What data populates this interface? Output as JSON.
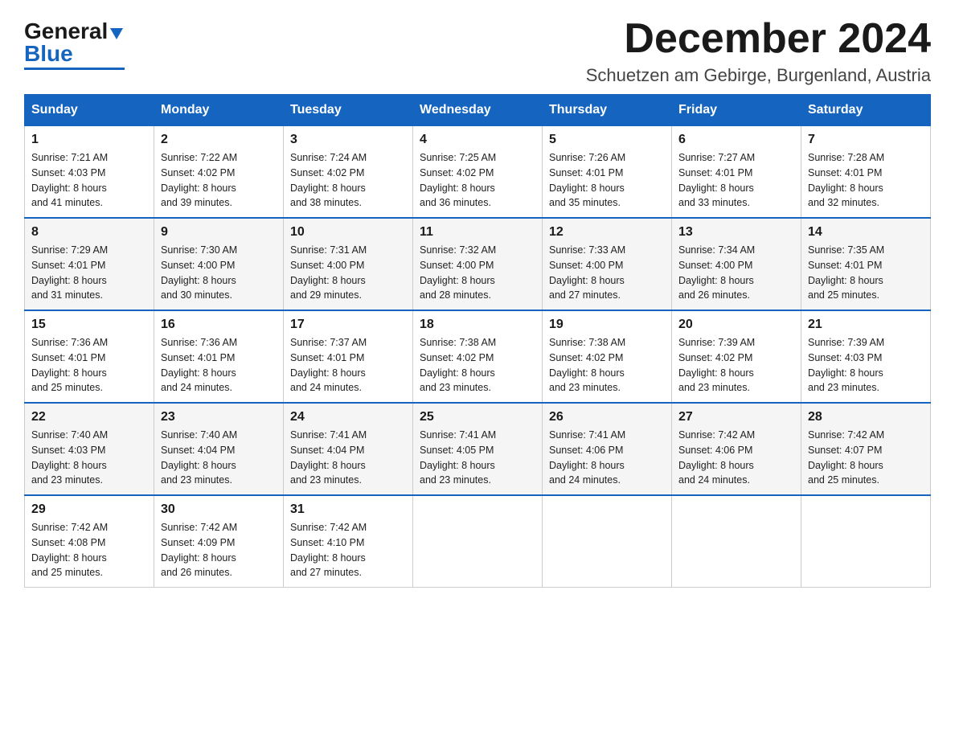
{
  "header": {
    "logo_general": "General",
    "logo_blue": "Blue",
    "month_title": "December 2024",
    "location": "Schuetzen am Gebirge, Burgenland, Austria"
  },
  "days_of_week": [
    "Sunday",
    "Monday",
    "Tuesday",
    "Wednesday",
    "Thursday",
    "Friday",
    "Saturday"
  ],
  "weeks": [
    [
      {
        "day": "1",
        "sunrise": "7:21 AM",
        "sunset": "4:03 PM",
        "daylight": "8 hours and 41 minutes."
      },
      {
        "day": "2",
        "sunrise": "7:22 AM",
        "sunset": "4:02 PM",
        "daylight": "8 hours and 39 minutes."
      },
      {
        "day": "3",
        "sunrise": "7:24 AM",
        "sunset": "4:02 PM",
        "daylight": "8 hours and 38 minutes."
      },
      {
        "day": "4",
        "sunrise": "7:25 AM",
        "sunset": "4:02 PM",
        "daylight": "8 hours and 36 minutes."
      },
      {
        "day": "5",
        "sunrise": "7:26 AM",
        "sunset": "4:01 PM",
        "daylight": "8 hours and 35 minutes."
      },
      {
        "day": "6",
        "sunrise": "7:27 AM",
        "sunset": "4:01 PM",
        "daylight": "8 hours and 33 minutes."
      },
      {
        "day": "7",
        "sunrise": "7:28 AM",
        "sunset": "4:01 PM",
        "daylight": "8 hours and 32 minutes."
      }
    ],
    [
      {
        "day": "8",
        "sunrise": "7:29 AM",
        "sunset": "4:01 PM",
        "daylight": "8 hours and 31 minutes."
      },
      {
        "day": "9",
        "sunrise": "7:30 AM",
        "sunset": "4:00 PM",
        "daylight": "8 hours and 30 minutes."
      },
      {
        "day": "10",
        "sunrise": "7:31 AM",
        "sunset": "4:00 PM",
        "daylight": "8 hours and 29 minutes."
      },
      {
        "day": "11",
        "sunrise": "7:32 AM",
        "sunset": "4:00 PM",
        "daylight": "8 hours and 28 minutes."
      },
      {
        "day": "12",
        "sunrise": "7:33 AM",
        "sunset": "4:00 PM",
        "daylight": "8 hours and 27 minutes."
      },
      {
        "day": "13",
        "sunrise": "7:34 AM",
        "sunset": "4:00 PM",
        "daylight": "8 hours and 26 minutes."
      },
      {
        "day": "14",
        "sunrise": "7:35 AM",
        "sunset": "4:01 PM",
        "daylight": "8 hours and 25 minutes."
      }
    ],
    [
      {
        "day": "15",
        "sunrise": "7:36 AM",
        "sunset": "4:01 PM",
        "daylight": "8 hours and 25 minutes."
      },
      {
        "day": "16",
        "sunrise": "7:36 AM",
        "sunset": "4:01 PM",
        "daylight": "8 hours and 24 minutes."
      },
      {
        "day": "17",
        "sunrise": "7:37 AM",
        "sunset": "4:01 PM",
        "daylight": "8 hours and 24 minutes."
      },
      {
        "day": "18",
        "sunrise": "7:38 AM",
        "sunset": "4:02 PM",
        "daylight": "8 hours and 23 minutes."
      },
      {
        "day": "19",
        "sunrise": "7:38 AM",
        "sunset": "4:02 PM",
        "daylight": "8 hours and 23 minutes."
      },
      {
        "day": "20",
        "sunrise": "7:39 AM",
        "sunset": "4:02 PM",
        "daylight": "8 hours and 23 minutes."
      },
      {
        "day": "21",
        "sunrise": "7:39 AM",
        "sunset": "4:03 PM",
        "daylight": "8 hours and 23 minutes."
      }
    ],
    [
      {
        "day": "22",
        "sunrise": "7:40 AM",
        "sunset": "4:03 PM",
        "daylight": "8 hours and 23 minutes."
      },
      {
        "day": "23",
        "sunrise": "7:40 AM",
        "sunset": "4:04 PM",
        "daylight": "8 hours and 23 minutes."
      },
      {
        "day": "24",
        "sunrise": "7:41 AM",
        "sunset": "4:04 PM",
        "daylight": "8 hours and 23 minutes."
      },
      {
        "day": "25",
        "sunrise": "7:41 AM",
        "sunset": "4:05 PM",
        "daylight": "8 hours and 23 minutes."
      },
      {
        "day": "26",
        "sunrise": "7:41 AM",
        "sunset": "4:06 PM",
        "daylight": "8 hours and 24 minutes."
      },
      {
        "day": "27",
        "sunrise": "7:42 AM",
        "sunset": "4:06 PM",
        "daylight": "8 hours and 24 minutes."
      },
      {
        "day": "28",
        "sunrise": "7:42 AM",
        "sunset": "4:07 PM",
        "daylight": "8 hours and 25 minutes."
      }
    ],
    [
      {
        "day": "29",
        "sunrise": "7:42 AM",
        "sunset": "4:08 PM",
        "daylight": "8 hours and 25 minutes."
      },
      {
        "day": "30",
        "sunrise": "7:42 AM",
        "sunset": "4:09 PM",
        "daylight": "8 hours and 26 minutes."
      },
      {
        "day": "31",
        "sunrise": "7:42 AM",
        "sunset": "4:10 PM",
        "daylight": "8 hours and 27 minutes."
      },
      null,
      null,
      null,
      null
    ]
  ],
  "labels": {
    "sunrise": "Sunrise:",
    "sunset": "Sunset:",
    "daylight": "Daylight:"
  }
}
